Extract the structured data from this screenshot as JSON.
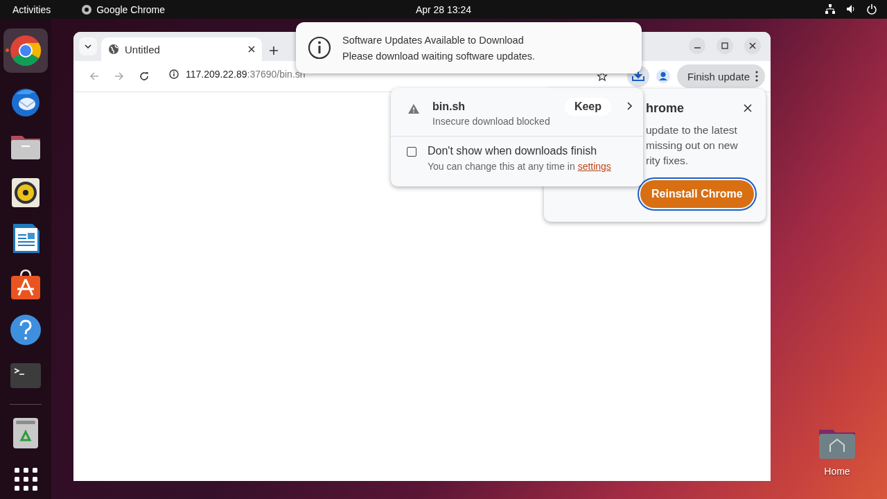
{
  "top_bar": {
    "activities": "Activities",
    "app_name": "Google Chrome",
    "clock": "Apr 28  13:24"
  },
  "dock": {
    "items": [
      {
        "kind": "chrome",
        "running": true,
        "selected": true
      },
      {
        "kind": "mail",
        "running": false,
        "selected": false
      },
      {
        "kind": "files",
        "running": false,
        "selected": false
      },
      {
        "kind": "music",
        "running": false,
        "selected": false
      },
      {
        "kind": "writer",
        "running": false,
        "selected": false
      },
      {
        "kind": "store",
        "running": false,
        "selected": false
      },
      {
        "kind": "help",
        "running": false,
        "selected": false
      },
      {
        "kind": "terminal",
        "running": false,
        "selected": false
      },
      {
        "kind": "trash",
        "running": false,
        "selected": false
      },
      {
        "kind": "apps",
        "running": false,
        "selected": false
      }
    ]
  },
  "browser": {
    "tabs": [
      {
        "title": "Untitled",
        "selected": true
      }
    ],
    "url_host": "117.209.22.89",
    "url_path": ":37690/bin.sh",
    "finish_update": "Finish update"
  },
  "notification": {
    "title": "Software Updates Available to Download",
    "body": "Please download waiting software updates."
  },
  "download_bubble": {
    "items": [
      {
        "filename": "bin.sh",
        "status": "Insecure download blocked",
        "action": "Keep"
      }
    ],
    "dont_show": {
      "label": "Don't show when downloads finish",
      "checked": false,
      "hint": "You can change this at any time in",
      "link": "settings"
    }
  },
  "update_bubble": {
    "title": "hrome",
    "lines": [
      "update to the latest",
      "missing out on new",
      "rity fixes."
    ],
    "button": "Reinstall Chrome"
  },
  "desktop_icons": [
    {
      "label": "Home"
    }
  ]
}
